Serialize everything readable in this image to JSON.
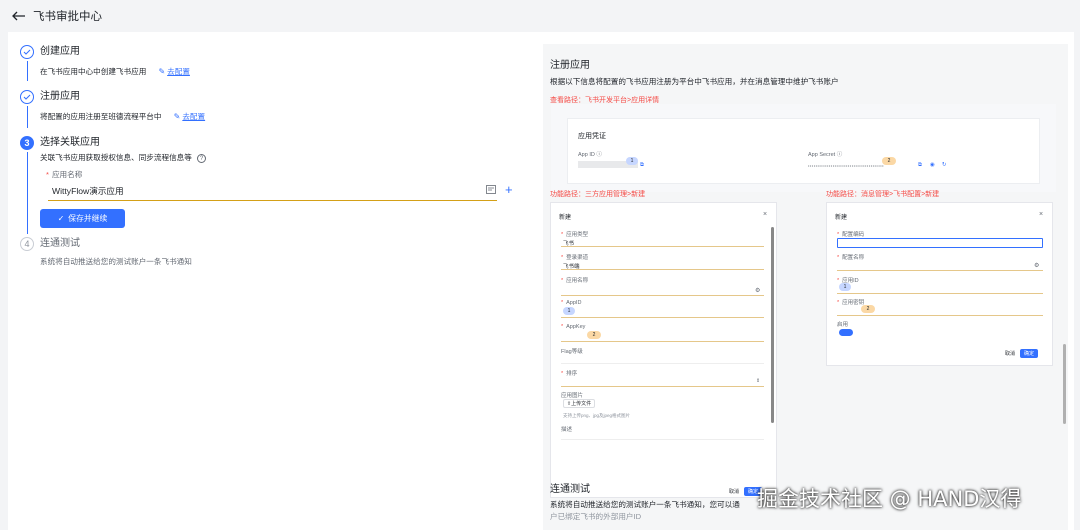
{
  "header": {
    "title": "飞书审批中心"
  },
  "steps": [
    {
      "title": "创建应用",
      "desc": "在飞书应用中心中创建飞书应用",
      "link": "去配置"
    },
    {
      "title": "注册应用",
      "desc": "将配置的应用注册至班德流程平台中",
      "link": "去配置"
    },
    {
      "number": "3",
      "title": "选择关联应用",
      "desc": "关联飞书应用获取授权信息、同步流程信息等",
      "field_label": "应用名称",
      "field_value": "WittyFlow演示应用",
      "save_button": "保存并继续"
    },
    {
      "number": "4",
      "title": "连通测试",
      "desc": "系统将自动推送给您的测试账户一条飞书通知"
    }
  ],
  "right": {
    "register_title": "注册应用",
    "register_desc": "根据以下信息将配置的飞书应用注册为平台中飞书应用，并在消息管理中维护飞书账户",
    "view_path": "查看路径：飞书开发平台>应用详情",
    "credentials": {
      "title": "应用凭证",
      "app_id_label": "App ID",
      "app_id_badge": "1",
      "secret_label": "App Secret",
      "secret_mask": "••••••••••••••••••••••••••••••••••••••••",
      "secret_badge": "2"
    },
    "path_left": "功能路径：三方应用管理>新建",
    "path_right": "功能路径：消息管理>飞书配置>新建",
    "dialog_left": {
      "title": "新建",
      "close": "×",
      "fields": [
        {
          "label": "应用类型",
          "value": "飞书"
        },
        {
          "label": "登录渠道",
          "value": "飞书端"
        },
        {
          "label": "应用名称",
          "value": ""
        },
        {
          "label": "AppID",
          "value": "1"
        },
        {
          "label": "AppKey",
          "value": "2"
        },
        {
          "label": "Flag等级",
          "value": ""
        },
        {
          "label": "排序",
          "value": ""
        }
      ],
      "logo_label": "应用图片",
      "upload": "上传文件",
      "upload_hint": "支持上传png、jpg及jpeg格式图片",
      "desc_label": "描述",
      "cancel": "取消",
      "ok": "确定"
    },
    "dialog_right": {
      "title": "新建",
      "close": "×",
      "fields": [
        {
          "label": "配置编码",
          "value": ""
        },
        {
          "label": "配置名称",
          "value": ""
        },
        {
          "label": "应用ID",
          "value": "1"
        },
        {
          "label": "应用密钥",
          "value": "2"
        },
        {
          "label": "启用",
          "value": ""
        }
      ],
      "cancel": "取消",
      "ok": "确定"
    },
    "test_title": "连通测试",
    "test_desc": "系统将自动推送给您的测试账户一条飞书通知，您可以通",
    "test_desc2": "户已绑定飞书的外部用户ID"
  },
  "watermark": "掘金技术社区 @ HAND汉得"
}
